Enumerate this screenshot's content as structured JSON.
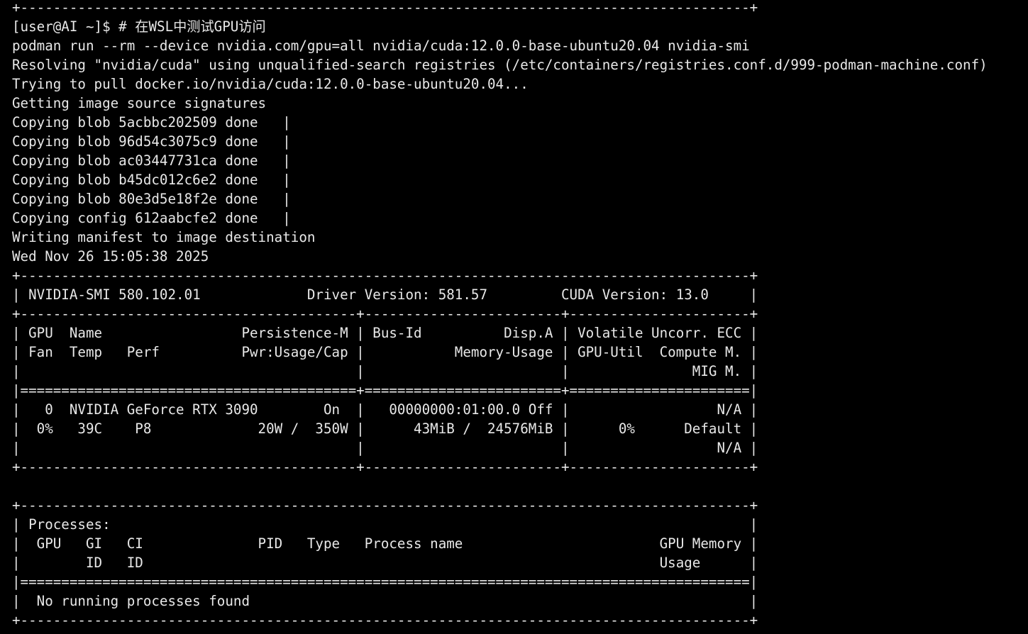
{
  "terminal": {
    "background": "#000000",
    "foreground": "#e8e8e8",
    "lines": [
      "+-----------------------------------------------------------------------------------------+",
      "[user@AI ~]$ # 在WSL中测试GPU访问",
      "podman run --rm --device nvidia.com/gpu=all nvidia/cuda:12.0.0-base-ubuntu20.04 nvidia-smi",
      "Resolving \"nvidia/cuda\" using unqualified-search registries (/etc/containers/registries.conf.d/999-podman-machine.conf)",
      "Trying to pull docker.io/nvidia/cuda:12.0.0-base-ubuntu20.04...",
      "Getting image source signatures",
      "Copying blob 5acbbc202509 done   |",
      "Copying blob 96d54c3075c9 done   |",
      "Copying blob ac03447731ca done   |",
      "Copying blob b45dc012c6e2 done   |",
      "Copying blob 80e3d5e18f2e done   |",
      "Copying config 612aabcfe2 done   |",
      "Writing manifest to image destination",
      "Wed Nov 26 15:05:38 2025",
      "+-----------------------------------------------------------------------------------------+",
      "| NVIDIA-SMI 580.102.01             Driver Version: 581.57         CUDA Version: 13.0     |",
      "+-----------------------------------------+------------------------+----------------------+",
      "| GPU  Name                 Persistence-M | Bus-Id          Disp.A | Volatile Uncorr. ECC |",
      "| Fan  Temp   Perf          Pwr:Usage/Cap |           Memory-Usage | GPU-Util  Compute M. |",
      "|                                         |                        |               MIG M. |",
      "|=========================================+========================+======================|",
      "|   0  NVIDIA GeForce RTX 3090        On  |   00000000:01:00.0 Off |                  N/A |",
      "|  0%   39C    P8             20W /  350W |      43MiB /  24576MiB |      0%      Default |",
      "|                                         |                        |                  N/A |",
      "+-----------------------------------------+------------------------+----------------------+",
      "",
      "+-----------------------------------------------------------------------------------------+",
      "| Processes:                                                                              |",
      "|  GPU   GI   CI              PID   Type   Process name                        GPU Memory |",
      "|        ID   ID                                                               Usage      |",
      "|=========================================================================================|",
      "|  No running processes found                                                             |",
      "+-----------------------------------------------------------------------------------------+"
    ]
  }
}
